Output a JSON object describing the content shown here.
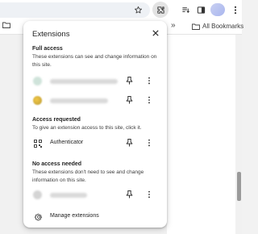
{
  "toolbar": {
    "icons": [
      "star-icon",
      "extensions-puzzle-icon",
      "reading-list-icon",
      "side-panel-icon",
      "avatar",
      "more-vert-icon"
    ]
  },
  "bookmarks_bar": {
    "overflow_chevron": "»",
    "all_bookmarks_label": "All Bookmarks"
  },
  "popup": {
    "title": "Extensions",
    "close_icon": "close-icon",
    "sections": {
      "full_access": {
        "title": "Full access",
        "description": "These extensions can see and change information on this site."
      },
      "access_requested": {
        "title": "Access requested",
        "description": "To give an extension access to this site, click it."
      },
      "no_access": {
        "title": "No access needed",
        "description": "These extensions don't need to see and change information on this site."
      }
    },
    "extensions": {
      "authenticator": {
        "name": "Authenticator"
      }
    },
    "manage_label": "Manage extensions"
  },
  "colors": {
    "popup_bg": "#ffffff",
    "page_bg": "#f1f1f1",
    "text": "#1f1f1f",
    "secondary_text": "#3c3c3c",
    "extensions_button_bg": "#e3e3e3"
  }
}
